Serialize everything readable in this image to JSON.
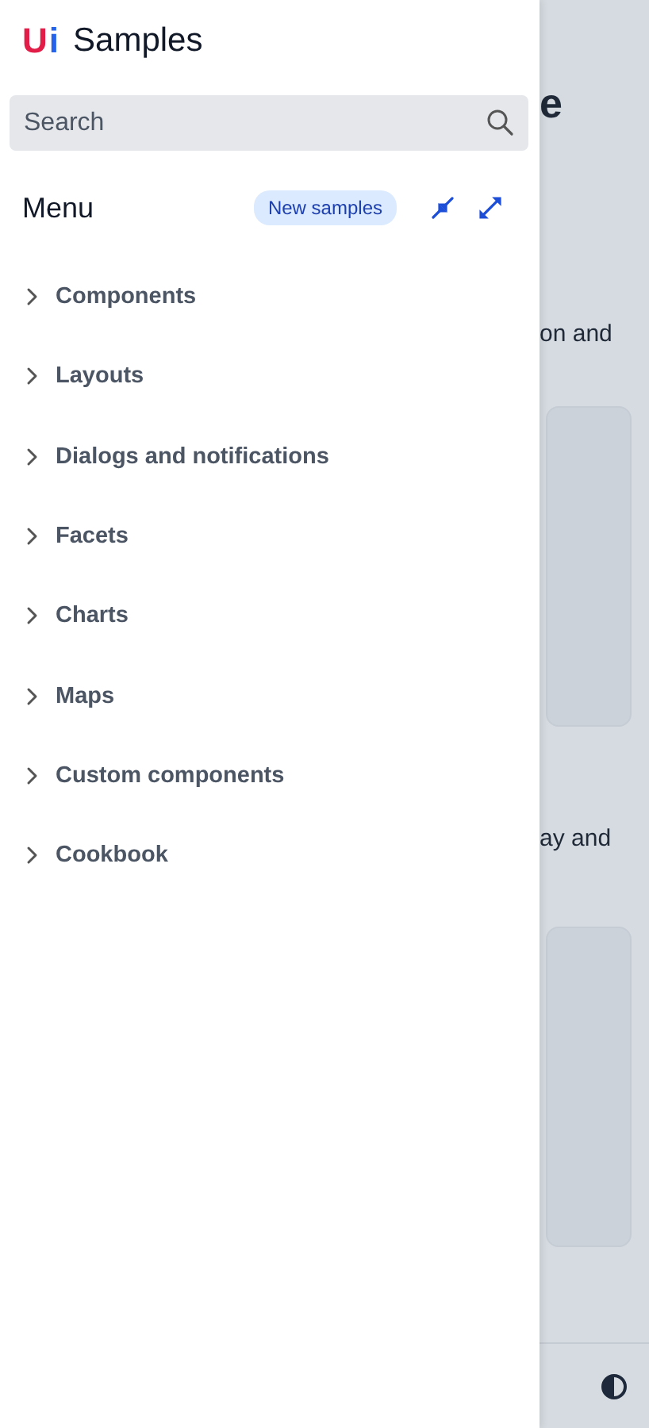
{
  "drawer": {
    "logo": {
      "mark_left": "U",
      "mark_right": "i",
      "title": "Samples"
    },
    "search": {
      "placeholder": "Search"
    },
    "menu": {
      "title": "Menu",
      "badge": "New samples"
    },
    "items": [
      {
        "label": "Components",
        "expanded": false
      },
      {
        "label": "Layouts",
        "expanded": false
      },
      {
        "label": "Dialogs and notifications",
        "expanded": false
      },
      {
        "label": "Facets",
        "expanded": false
      },
      {
        "label": "Charts",
        "expanded": false
      },
      {
        "label": "Maps",
        "expanded": false
      },
      {
        "label": "Custom components",
        "expanded": false
      },
      {
        "label": "Cookbook",
        "expanded": false
      }
    ]
  },
  "page": {
    "heading": "e",
    "paragraph_1": "on and",
    "paragraph_2": "ay and"
  }
}
